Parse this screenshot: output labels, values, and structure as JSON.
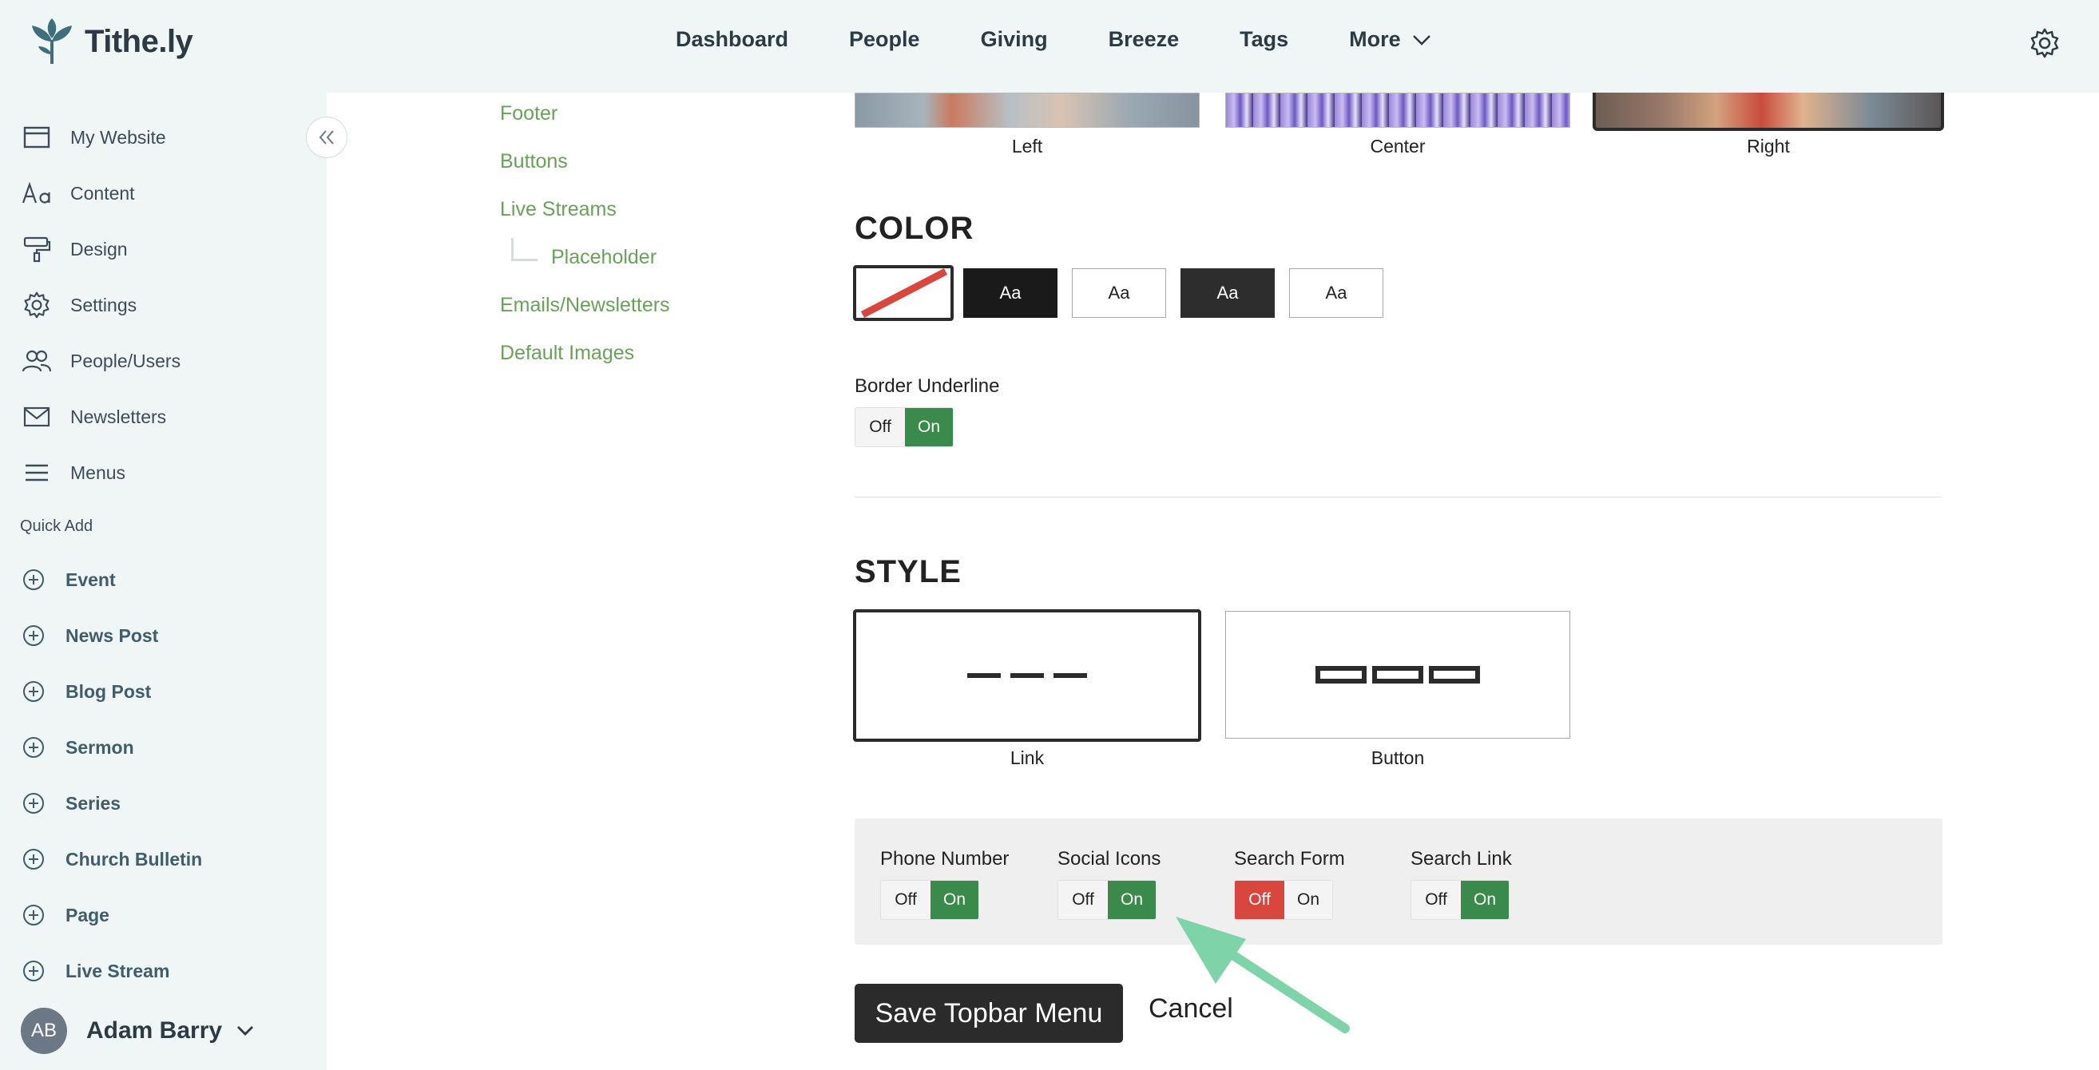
{
  "brand": {
    "name": "Tithe.ly"
  },
  "nav": {
    "items": [
      "Dashboard",
      "People",
      "Giving",
      "Breeze",
      "Tags"
    ],
    "more": "More"
  },
  "sidebar": {
    "items": [
      {
        "label": "My Website",
        "icon": "browser-window-icon"
      },
      {
        "label": "Content",
        "icon": "text-aa-icon"
      },
      {
        "label": "Design",
        "icon": "paint-roller-icon"
      },
      {
        "label": "Settings",
        "icon": "gear-icon"
      },
      {
        "label": "People/Users",
        "icon": "users-icon"
      },
      {
        "label": "Newsletters",
        "icon": "envelope-icon"
      },
      {
        "label": "Menus",
        "icon": "hamburger-icon"
      }
    ],
    "quick_add_label": "Quick Add",
    "quick_add": [
      "Event",
      "News Post",
      "Blog Post",
      "Sermon",
      "Series",
      "Church Bulletin",
      "Page",
      "Live Stream"
    ]
  },
  "user": {
    "initials": "AB",
    "name": "Adam Barry"
  },
  "subnav": {
    "items": [
      "Footer",
      "Buttons",
      "Live Streams",
      "Placeholder",
      "Emails/Newsletters",
      "Default Images"
    ]
  },
  "alignment": {
    "options": [
      "Left",
      "Center",
      "Right"
    ],
    "selected": "Right"
  },
  "color": {
    "title": "COLOR",
    "swatch_text": "Aa",
    "border_underline_label": "Border Underline",
    "border_underline_value": "On"
  },
  "toggle_labels": {
    "off": "Off",
    "on": "On"
  },
  "style": {
    "title": "STYLE",
    "options": [
      "Link",
      "Button"
    ],
    "selected": "Link"
  },
  "toggles": [
    {
      "label": "Phone Number",
      "value": "On"
    },
    {
      "label": "Social Icons",
      "value": "On"
    },
    {
      "label": "Search Form",
      "value": "Off"
    },
    {
      "label": "Search Link",
      "value": "On"
    }
  ],
  "actions": {
    "save": "Save Topbar Menu",
    "cancel": "Cancel"
  },
  "colors": {
    "accent_green": "#3a8a4c",
    "link_green": "#6aa15a",
    "off_red": "#d9463d",
    "arrow": "#7fd3a8"
  }
}
